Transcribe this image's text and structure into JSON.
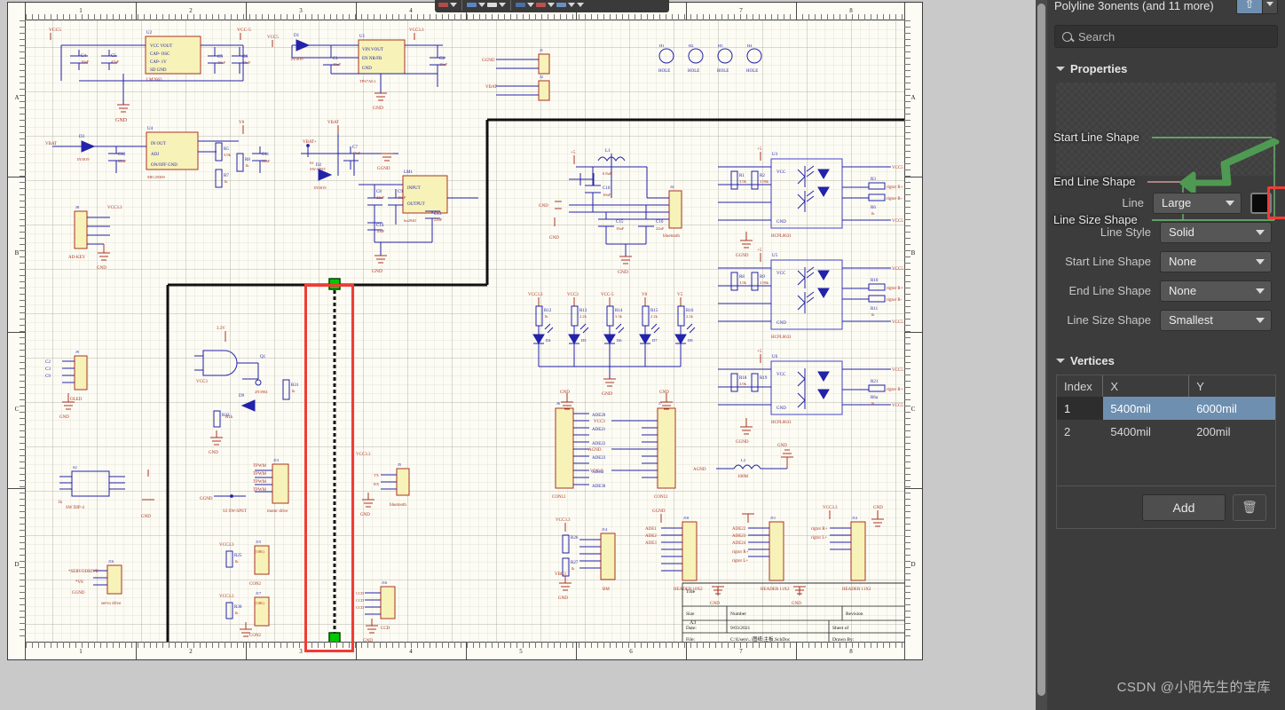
{
  "panel": {
    "title": "Polyline  3onents (and 11 more)",
    "pin_icon": "pin-icon",
    "caret_icon": "chevron-down-icon",
    "search": {
      "placeholder": "Search",
      "value": "",
      "icon": "search-icon"
    },
    "sections": {
      "properties": "Properties",
      "vertices": "Vertices"
    },
    "annotations": [
      {
        "label": "Start Line Shape"
      },
      {
        "label": "End Line Shape"
      },
      {
        "label": "Line Size Shape"
      }
    ],
    "form": [
      {
        "label": "Line",
        "value": "Large",
        "swatch": "#0a0a0a",
        "highlighted": true
      },
      {
        "label": "Line Style",
        "value": "Solid",
        "highlighted": false
      },
      {
        "label": "Start Line Shape",
        "value": "None",
        "highlighted": false
      },
      {
        "label": "End Line Shape",
        "value": "None",
        "highlighted": false
      },
      {
        "label": "Line Size Shape",
        "value": "Smallest",
        "highlighted": false
      }
    ],
    "vertices": {
      "columns": [
        "Index",
        "X",
        "Y"
      ],
      "rows": [
        {
          "index": "1",
          "x": "5400mil",
          "y": "6000mil",
          "selected": true
        },
        {
          "index": "2",
          "x": "5400mil",
          "y": "200mil",
          "selected": false
        }
      ],
      "add_label": "Add",
      "delete_icon": "trash-icon"
    },
    "accent_color": "#6e8fb0",
    "highlight_color": "#f23b35"
  },
  "canvas": {
    "zone_columns": [
      "1",
      "2",
      "3",
      "4",
      "5",
      "6",
      "7",
      "8"
    ],
    "zone_rows": [
      "A",
      "B",
      "C",
      "D"
    ],
    "title_block": {
      "title_label": "Title",
      "size_label": "Size",
      "size_value": "A3",
      "number_label": "Number",
      "revision_label": "Revision",
      "date_label": "Date:",
      "date_value": "9/03/2021",
      "sheet_label": "Sheet  of",
      "file_label": "File:",
      "file_value": "C:\\Users\\..\\图纸\\主板.SchDoc",
      "drawn_label": "Drawn By:"
    },
    "toolbar_icon": "formatting-toolbar"
  },
  "watermark": "CSDN @小阳先生的宝库"
}
